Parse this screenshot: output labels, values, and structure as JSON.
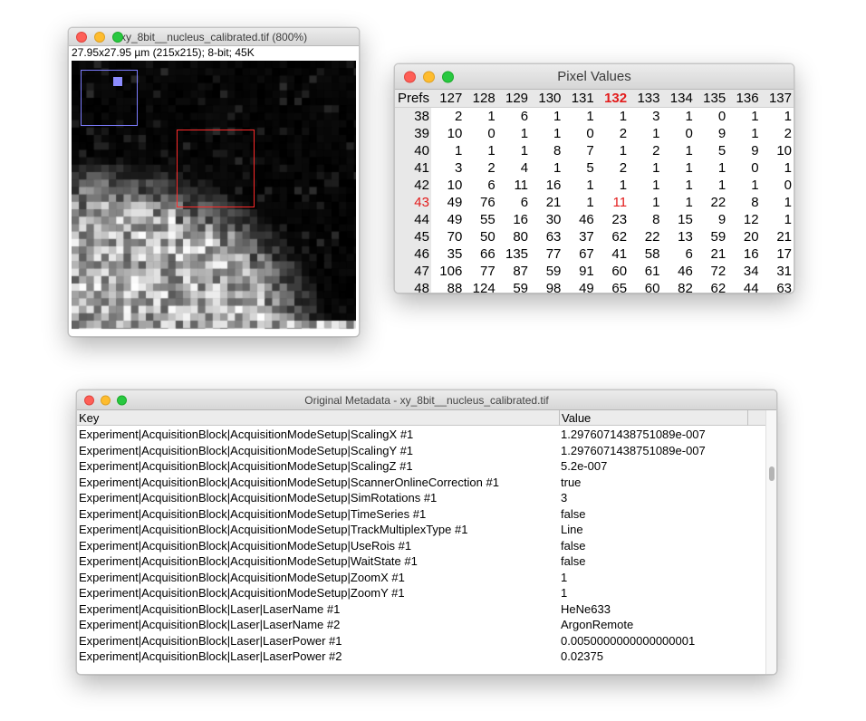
{
  "image_window": {
    "title": "xy_8bit__nucleus_calibrated.tif (800%)",
    "info": "27.95x27.95 µm (215x215); 8-bit; 45K"
  },
  "pixel_values": {
    "title": "Pixel Values",
    "corner": "Prefs",
    "highlight_col": "132",
    "highlight_row": "43",
    "columns": [
      "127",
      "128",
      "129",
      "130",
      "131",
      "132",
      "133",
      "134",
      "135",
      "136",
      "137"
    ],
    "rows": [
      {
        "y": "38",
        "v": [
          "2",
          "1",
          "6",
          "1",
          "1",
          "1",
          "3",
          "1",
          "0",
          "1",
          "1"
        ]
      },
      {
        "y": "39",
        "v": [
          "10",
          "0",
          "1",
          "1",
          "0",
          "2",
          "1",
          "0",
          "9",
          "1",
          "2"
        ]
      },
      {
        "y": "40",
        "v": [
          "1",
          "1",
          "1",
          "8",
          "7",
          "1",
          "2",
          "1",
          "5",
          "9",
          "10"
        ]
      },
      {
        "y": "41",
        "v": [
          "3",
          "2",
          "4",
          "1",
          "5",
          "2",
          "1",
          "1",
          "1",
          "0",
          "1"
        ]
      },
      {
        "y": "42",
        "v": [
          "10",
          "6",
          "11",
          "16",
          "1",
          "1",
          "1",
          "1",
          "1",
          "1",
          "0"
        ]
      },
      {
        "y": "43",
        "v": [
          "49",
          "76",
          "6",
          "21",
          "1",
          "11",
          "1",
          "1",
          "22",
          "8",
          "1"
        ]
      },
      {
        "y": "44",
        "v": [
          "49",
          "55",
          "16",
          "30",
          "46",
          "23",
          "8",
          "15",
          "9",
          "12",
          "1"
        ]
      },
      {
        "y": "45",
        "v": [
          "70",
          "50",
          "80",
          "63",
          "37",
          "62",
          "22",
          "13",
          "59",
          "20",
          "21"
        ]
      },
      {
        "y": "46",
        "v": [
          "35",
          "66",
          "135",
          "77",
          "67",
          "41",
          "58",
          "6",
          "21",
          "16",
          "17"
        ]
      },
      {
        "y": "47",
        "v": [
          "106",
          "77",
          "87",
          "59",
          "91",
          "60",
          "61",
          "46",
          "72",
          "34",
          "31"
        ]
      },
      {
        "y": "48",
        "v": [
          "88",
          "124",
          "59",
          "98",
          "49",
          "65",
          "60",
          "82",
          "62",
          "44",
          "63"
        ]
      }
    ]
  },
  "metadata": {
    "title": "Original Metadata - xy_8bit__nucleus_calibrated.tif",
    "header_key": "Key",
    "header_value": "Value",
    "rows": [
      {
        "key": "Experiment|AcquisitionBlock|AcquisitionModeSetup|ScalingX #1",
        "value": "1.2976071438751089e-007"
      },
      {
        "key": "Experiment|AcquisitionBlock|AcquisitionModeSetup|ScalingY #1",
        "value": "1.2976071438751089e-007"
      },
      {
        "key": "Experiment|AcquisitionBlock|AcquisitionModeSetup|ScalingZ #1",
        "value": "5.2e-007"
      },
      {
        "key": "Experiment|AcquisitionBlock|AcquisitionModeSetup|ScannerOnlineCorrection #1",
        "value": "true"
      },
      {
        "key": "Experiment|AcquisitionBlock|AcquisitionModeSetup|SimRotations #1",
        "value": "3"
      },
      {
        "key": "Experiment|AcquisitionBlock|AcquisitionModeSetup|TimeSeries #1",
        "value": "false"
      },
      {
        "key": "Experiment|AcquisitionBlock|AcquisitionModeSetup|TrackMultiplexType #1",
        "value": "Line"
      },
      {
        "key": "Experiment|AcquisitionBlock|AcquisitionModeSetup|UseRois #1",
        "value": "false"
      },
      {
        "key": "Experiment|AcquisitionBlock|AcquisitionModeSetup|WaitState #1",
        "value": "false"
      },
      {
        "key": "Experiment|AcquisitionBlock|AcquisitionModeSetup|ZoomX #1",
        "value": "1"
      },
      {
        "key": "Experiment|AcquisitionBlock|AcquisitionModeSetup|ZoomY #1",
        "value": "1"
      },
      {
        "key": "Experiment|AcquisitionBlock|Laser|LaserName #1",
        "value": "HeNe633"
      },
      {
        "key": "Experiment|AcquisitionBlock|Laser|LaserName #2",
        "value": "ArgonRemote"
      },
      {
        "key": "Experiment|AcquisitionBlock|Laser|LaserPower #1",
        "value": "0.0050000000000000001"
      },
      {
        "key": "Experiment|AcquisitionBlock|Laser|LaserPower #2",
        "value": "0.02375"
      }
    ]
  },
  "colors": {
    "highlight_red": "#e31b1b",
    "roi_red": "#ff2a2a",
    "roi_blue": "#7d7dff"
  }
}
